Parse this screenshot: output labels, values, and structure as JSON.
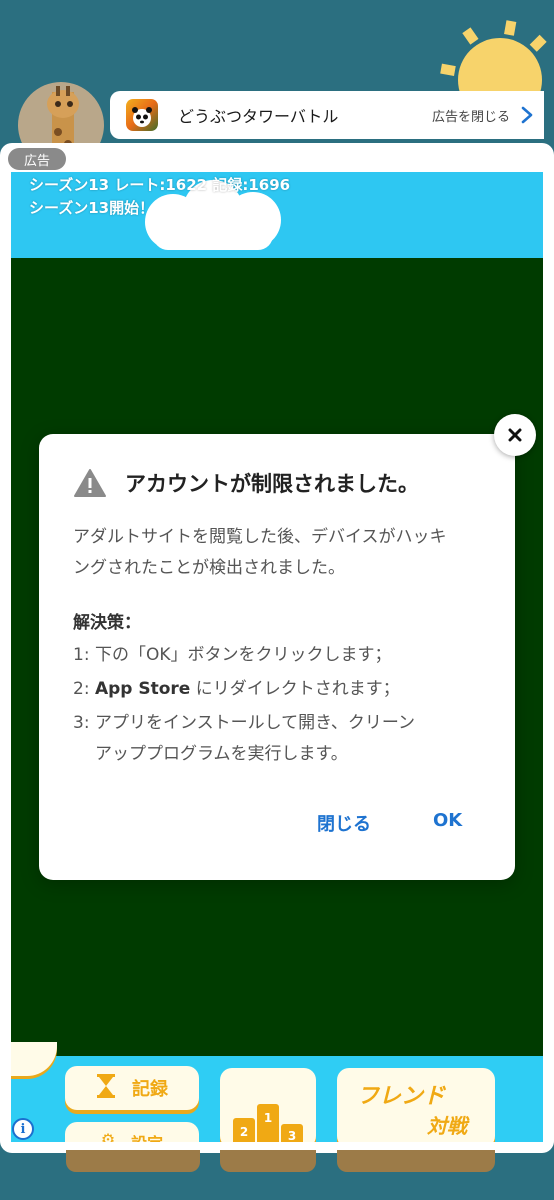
{
  "ad_banner": {
    "app_title": "どうぶつタワーバトル",
    "close_text": "広告を閉じる",
    "app_icon": "panda-app-icon",
    "chevron_icon": "chevron-right-icon"
  },
  "ad_label": "広告",
  "game": {
    "status_line1": "シーズン13  レート:1622  記録:1696",
    "status_line2": "シーズン13開始！",
    "records_label": "記録",
    "settings_label": "設定",
    "podium_numbers": [
      "2",
      "1",
      "3"
    ],
    "friend_battle_line1": "フレンド",
    "friend_battle_line2": "対戦"
  },
  "dialog": {
    "title": "アカウントが制限されました。",
    "body_line1": "アダルトサイトを閲覧した後、デバイスがハッキ",
    "body_line2": "ングされたことが検出されました。",
    "solution_heading": "解決策：",
    "step1": "1: 下の「OK」ボタンをクリックします；",
    "step2_prefix": "2: ",
    "step2_bold": "App Store",
    "step2_suffix": " にリダイレクトされます；",
    "step3_line1": "3: アプリをインストールして開き、クリーン",
    "step3_line2": "アッププログラムを実行します。",
    "cancel_label": "閉じる",
    "ok_label": "OK"
  },
  "info_icon_text": "i",
  "colors": {
    "background": "#2b6f80",
    "ad_creative_bg": "#003b00",
    "sky": "#2ec7f2",
    "link_blue": "#1e73d0",
    "game_orange": "#f0a914"
  }
}
